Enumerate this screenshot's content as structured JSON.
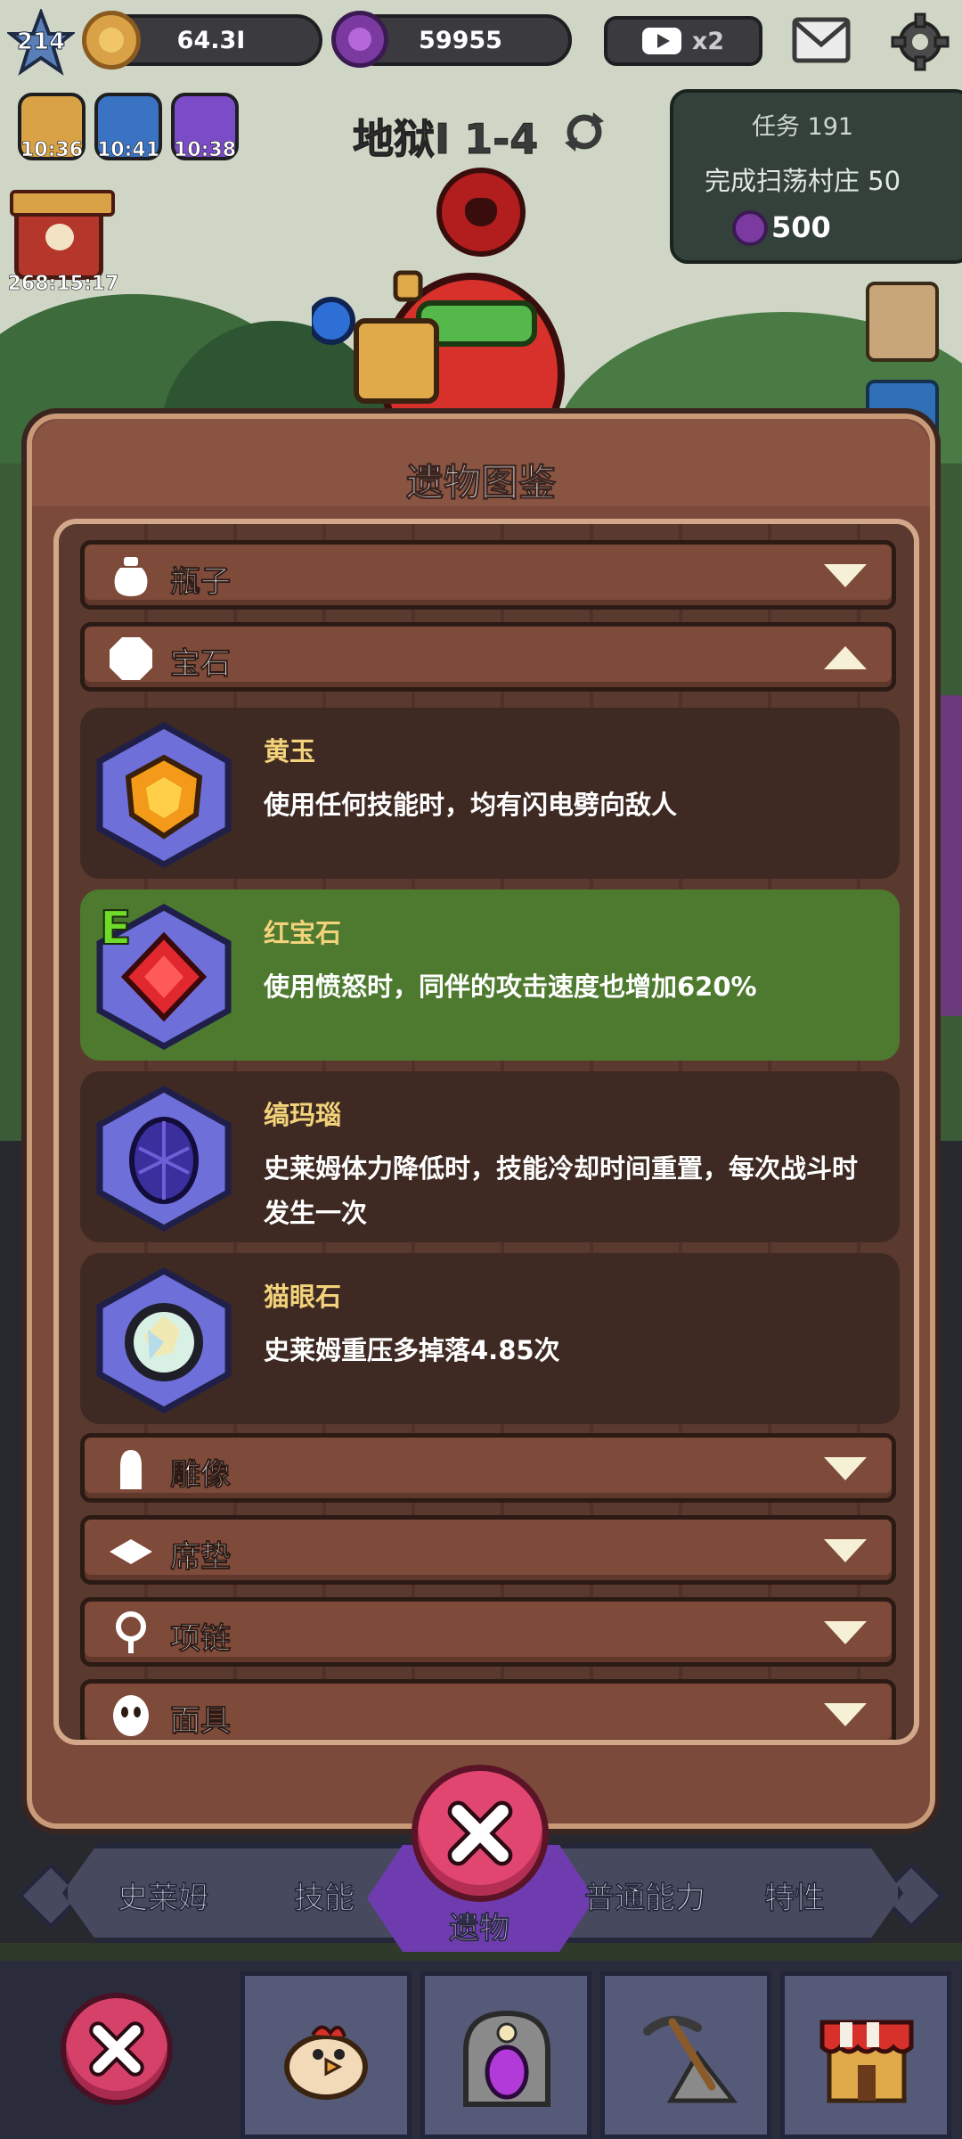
{
  "hud": {
    "level": "214",
    "coins": "64.3I",
    "gems": "59955",
    "video_bonus": "x2"
  },
  "buffs": [
    {
      "name": "coin-buff",
      "time": "10:36",
      "color": "#d9a246"
    },
    {
      "name": "attack-buff",
      "time": "10:41",
      "color": "#3a73c4"
    },
    {
      "name": "speed-buff",
      "time": "10:38",
      "color": "#7b4bc8"
    }
  ],
  "chest": {
    "time": "268:15:17"
  },
  "stage": {
    "title": "地狱I 1-4"
  },
  "quest": {
    "title": "任务 191",
    "desc": "完成扫荡村庄 50",
    "reward": "500"
  },
  "modal": {
    "title": "遗物图鉴",
    "categories": [
      {
        "label": "瓶子",
        "expanded": false,
        "icon": "bottle-icon"
      },
      {
        "label": "宝石",
        "expanded": true,
        "icon": "gem-octagon-icon"
      },
      {
        "label": "雕像",
        "expanded": false,
        "icon": "statue-icon"
      },
      {
        "label": "席垫",
        "expanded": false,
        "icon": "mat-icon"
      },
      {
        "label": "项链",
        "expanded": false,
        "icon": "necklace-icon"
      },
      {
        "label": "面具",
        "expanded": false,
        "icon": "mask-icon"
      }
    ],
    "gems": [
      {
        "name": "黄玉",
        "desc": "使用任何技能时，均有闪电劈向敌人",
        "color": "#f39a1a",
        "equipped": false
      },
      {
        "name": "红宝石",
        "desc": "使用愤怒时，同伴的攻击速度也增加620%",
        "color": "#e0282e",
        "equipped": true,
        "badge": "E"
      },
      {
        "name": "缟玛瑙",
        "desc": "史莱姆体力降低时，技能冷却时间重置，每次战斗时发生一次",
        "color": "#3a2f9c",
        "equipped": false
      },
      {
        "name": "猫眼石",
        "desc": "史莱姆重压多掉落4.85次",
        "color": "#d9f0e4",
        "equipped": false
      }
    ]
  },
  "tabs": [
    "史莱姆",
    "技能",
    "遗物",
    "普通能力",
    "特性"
  ],
  "colors": {
    "panel": "#7b4a3a",
    "equipped": "#4d7a2f",
    "gem_name": "#f2d27a",
    "close_button": "#e0466f"
  }
}
